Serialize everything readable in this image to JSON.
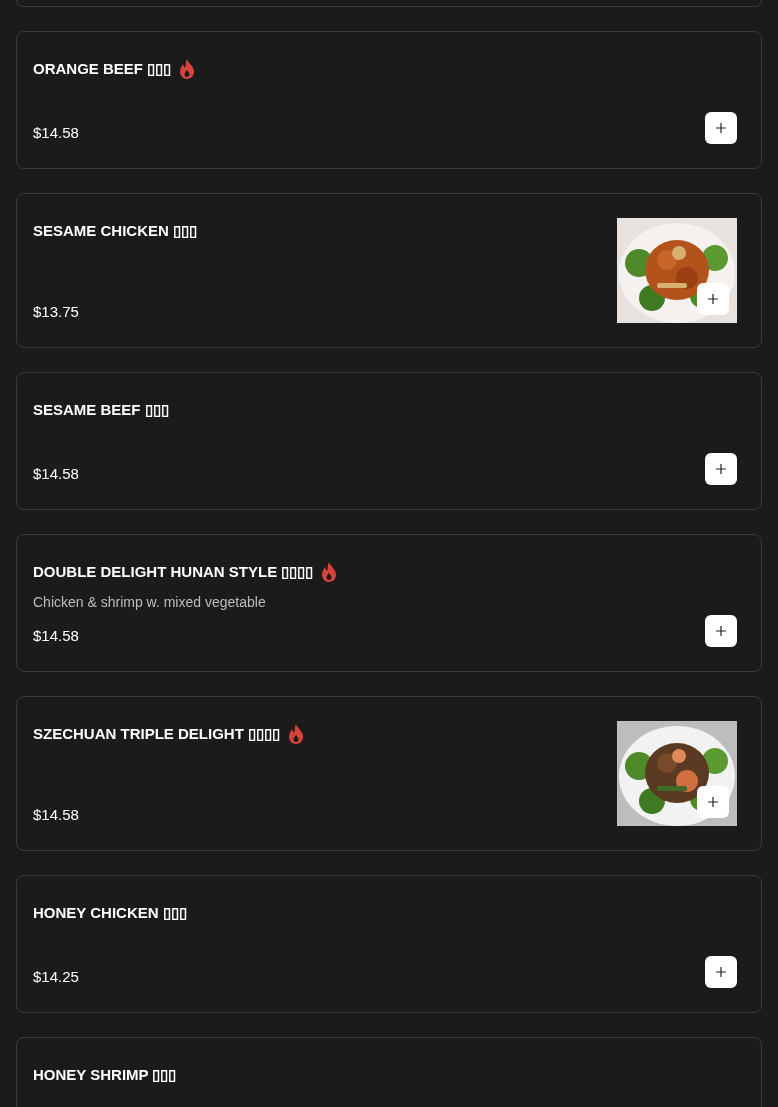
{
  "items": [
    {
      "name": "ORANGE BEEF ▯▯▯",
      "spicy": true,
      "price": "$14.58"
    },
    {
      "name": "SESAME CHICKEN ▯▯▯",
      "spicy": false,
      "price": "$13.75"
    },
    {
      "name": "SESAME BEEF ▯▯▯",
      "spicy": false,
      "price": "$14.58"
    },
    {
      "name": "DOUBLE DELIGHT HUNAN STYLE ▯▯▯▯",
      "spicy": true,
      "description": "Chicken & shrimp w. mixed vegetable",
      "price": "$14.58"
    },
    {
      "name": "SZECHUAN TRIPLE DELIGHT ▯▯▯▯",
      "spicy": true,
      "price": "$14.58"
    },
    {
      "name": "HONEY CHICKEN ▯▯▯",
      "spicy": false,
      "price": "$14.25"
    },
    {
      "name": "HONEY SHRIMP ▯▯▯",
      "spicy": false
    }
  ]
}
